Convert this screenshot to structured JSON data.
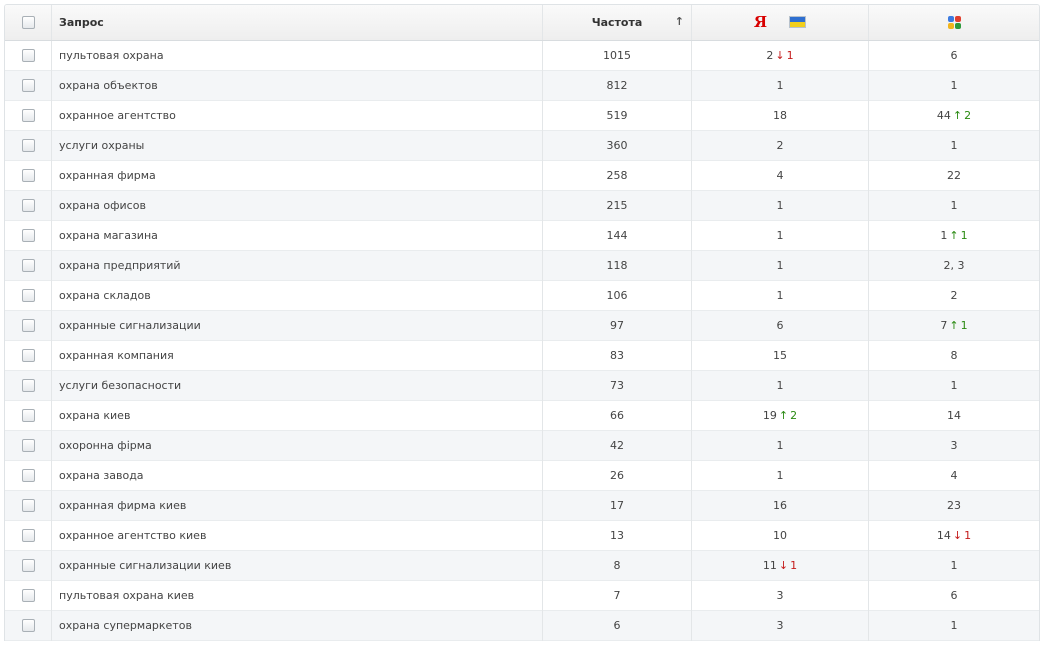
{
  "header": {
    "query": "Запрос",
    "frequency": "Частота",
    "sort_indicator": "↑",
    "yandex_letter": "Я",
    "yandex_region": "flag-ukraine-icon",
    "google_icon": "google-favicon-icon"
  },
  "colors": {
    "up": "#2a8a12",
    "down": "#c41b1b",
    "yandex": "#d80000"
  },
  "rows": [
    {
      "query": "пультовая охрана",
      "freq": "1015",
      "yandex": {
        "pos": "2",
        "dir": "down",
        "delta": "1"
      },
      "google": {
        "pos": "6"
      }
    },
    {
      "query": "охрана объектов",
      "freq": "812",
      "yandex": {
        "pos": "1"
      },
      "google": {
        "pos": "1"
      }
    },
    {
      "query": "охранное агентство",
      "freq": "519",
      "yandex": {
        "pos": "18"
      },
      "google": {
        "pos": "44",
        "dir": "up",
        "delta": "2"
      }
    },
    {
      "query": "услуги охраны",
      "freq": "360",
      "yandex": {
        "pos": "2"
      },
      "google": {
        "pos": "1"
      }
    },
    {
      "query": "охранная фирма",
      "freq": "258",
      "yandex": {
        "pos": "4"
      },
      "google": {
        "pos": "22"
      }
    },
    {
      "query": "охрана офисов",
      "freq": "215",
      "yandex": {
        "pos": "1"
      },
      "google": {
        "pos": "1"
      }
    },
    {
      "query": "охрана магазина",
      "freq": "144",
      "yandex": {
        "pos": "1"
      },
      "google": {
        "pos": "1",
        "dir": "up",
        "delta": "1"
      }
    },
    {
      "query": "охрана предприятий",
      "freq": "118",
      "yandex": {
        "pos": "1"
      },
      "google": {
        "pos": "2, 3"
      }
    },
    {
      "query": "охрана складов",
      "freq": "106",
      "yandex": {
        "pos": "1"
      },
      "google": {
        "pos": "2"
      }
    },
    {
      "query": "охранные сигнализации",
      "freq": "97",
      "yandex": {
        "pos": "6"
      },
      "google": {
        "pos": "7",
        "dir": "up",
        "delta": "1"
      }
    },
    {
      "query": "охранная компания",
      "freq": "83",
      "yandex": {
        "pos": "15"
      },
      "google": {
        "pos": "8"
      }
    },
    {
      "query": "услуги безопасности",
      "freq": "73",
      "yandex": {
        "pos": "1"
      },
      "google": {
        "pos": "1"
      }
    },
    {
      "query": "охрана киев",
      "freq": "66",
      "yandex": {
        "pos": "19",
        "dir": "up",
        "delta": "2"
      },
      "google": {
        "pos": "14"
      }
    },
    {
      "query": "охоронна фірма",
      "freq": "42",
      "yandex": {
        "pos": "1"
      },
      "google": {
        "pos": "3"
      }
    },
    {
      "query": "охрана завода",
      "freq": "26",
      "yandex": {
        "pos": "1"
      },
      "google": {
        "pos": "4"
      }
    },
    {
      "query": "охранная фирма киев",
      "freq": "17",
      "yandex": {
        "pos": "16"
      },
      "google": {
        "pos": "23"
      }
    },
    {
      "query": "охранное агентство киев",
      "freq": "13",
      "yandex": {
        "pos": "10"
      },
      "google": {
        "pos": "14",
        "dir": "down",
        "delta": "1"
      }
    },
    {
      "query": "охранные сигнализации киев",
      "freq": "8",
      "yandex": {
        "pos": "11",
        "dir": "down",
        "delta": "1"
      },
      "google": {
        "pos": "1"
      }
    },
    {
      "query": "пультовая охрана киев",
      "freq": "7",
      "yandex": {
        "pos": "3"
      },
      "google": {
        "pos": "6"
      }
    },
    {
      "query": "охрана супермаркетов",
      "freq": "6",
      "yandex": {
        "pos": "3"
      },
      "google": {
        "pos": "1"
      }
    }
  ]
}
